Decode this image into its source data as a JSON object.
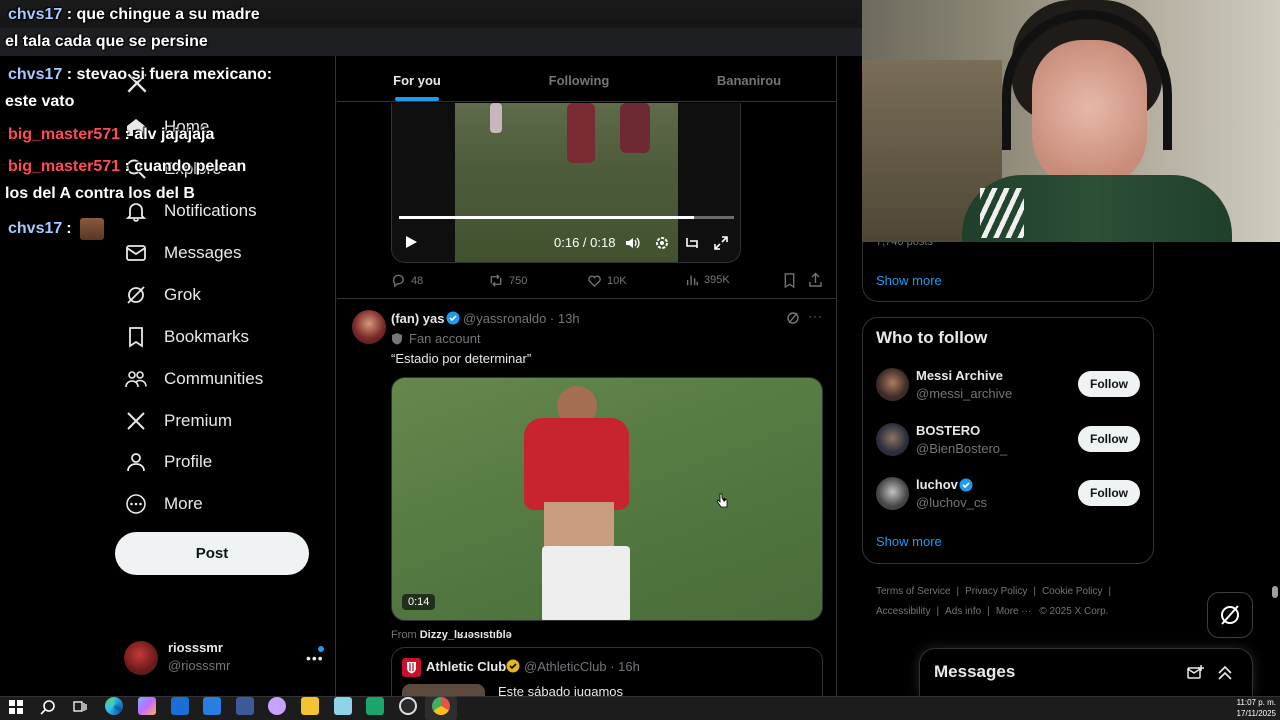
{
  "chat_overlay": {
    "lines": [
      {
        "user": "chvs17",
        "msg": ": que chingue a su madre"
      },
      {
        "user": "",
        "msg": "el tala cada que se persine"
      },
      {
        "user": "chvs17",
        "msg": ": stevao si fuera mexicano:"
      },
      {
        "user": "",
        "msg": "este vato"
      },
      {
        "user": "big_master571",
        "msg": ": alv jajajaja"
      },
      {
        "user": "big_master571",
        "msg": ": cuando pelean"
      },
      {
        "user": "",
        "msg": "los del A contra los del B"
      },
      {
        "user": "chvs17",
        "msg": ":"
      }
    ]
  },
  "sidebar": {
    "items": [
      {
        "label": "Home",
        "icon": "home-icon"
      },
      {
        "label": "Explore",
        "icon": "search-icon"
      },
      {
        "label": "Notifications",
        "icon": "bell-icon"
      },
      {
        "label": "Messages",
        "icon": "mail-icon"
      },
      {
        "label": "Grok",
        "icon": "grok-icon"
      },
      {
        "label": "Bookmarks",
        "icon": "bookmark-icon"
      },
      {
        "label": "Communities",
        "icon": "communities-icon"
      },
      {
        "label": "Premium",
        "icon": "x-logo-icon"
      },
      {
        "label": "Profile",
        "icon": "person-icon"
      },
      {
        "label": "More",
        "icon": "more-circle-icon"
      }
    ],
    "post_label": "Post",
    "account": {
      "name": "riosssmr",
      "handle": "@riosssmr"
    }
  },
  "tabs": [
    {
      "label": "For you",
      "active": true
    },
    {
      "label": "Following",
      "active": false
    },
    {
      "label": "Bananirou",
      "active": false
    }
  ],
  "video1": {
    "time": "0:16 / 0:18",
    "progress": 0.88,
    "stats": {
      "replies": "48",
      "reposts": "750",
      "likes": "10K",
      "views": "395K"
    }
  },
  "tweet": {
    "name": "(fan) yas",
    "handle": "@yassronaldo",
    "time": "13h",
    "badge": "Fan account",
    "text": "“Estadio por determinar”",
    "duration": "0:14",
    "from_label": "From",
    "from_user": "Dizzy_lʁɹǝsıstıɓlǝ",
    "quoted": {
      "name": "Athletic Club",
      "handle": "@AthleticClub",
      "time": "16h",
      "text": "Este sábado jugamos"
    }
  },
  "right": {
    "partial_text": "7,740 posts",
    "show_more": "Show more",
    "who_to_follow": {
      "title": "Who to follow",
      "accounts": [
        {
          "name": "Messi Archive",
          "handle": "@messi_archive",
          "verified": false
        },
        {
          "name": "BOSTERO",
          "handle": "@BienBostero_",
          "verified": false
        },
        {
          "name": "luchov",
          "handle": "@luchov_cs",
          "verified": true
        }
      ],
      "follow_label": "Follow",
      "show_more": "Show more"
    },
    "footer": {
      "links": [
        "Terms of Service",
        "Privacy Policy",
        "Cookie Policy",
        "Accessibility",
        "Ads info",
        "More ···"
      ],
      "copyright": "© 2025 X Corp."
    },
    "messages_label": "Messages"
  },
  "taskbar": {
    "time": "11:07 p. m.",
    "date": "17/11/2025"
  },
  "colors": {
    "accent": "#1d9bf0",
    "chat_user_blue": "#a9c8ff",
    "chat_user_red": "#ff4a5a"
  }
}
